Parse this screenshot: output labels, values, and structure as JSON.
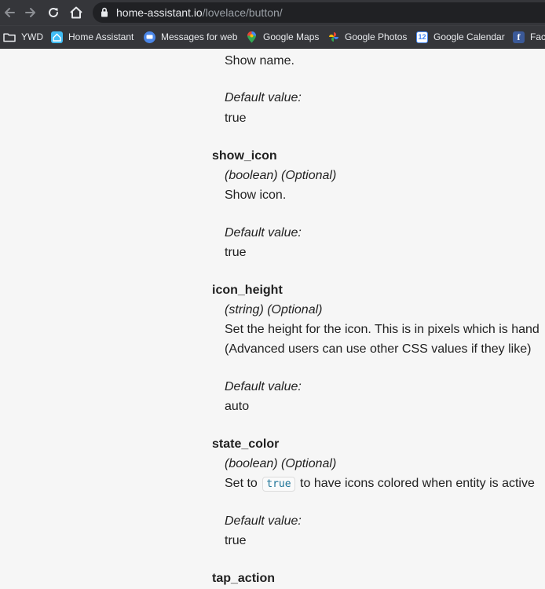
{
  "browser": {
    "url_host": "home-assistant.io",
    "url_path": "/lovelace/button/",
    "bookmarks": [
      {
        "label": "YWD",
        "icon": "folder-icon"
      },
      {
        "label": "Home Assistant",
        "icon": "home-assistant-icon"
      },
      {
        "label": "Messages for web",
        "icon": "messages-icon"
      },
      {
        "label": "Google Maps",
        "icon": "google-maps-icon"
      },
      {
        "label": "Google Photos",
        "icon": "google-photos-icon"
      },
      {
        "label": "Google Calendar",
        "icon": "google-calendar-icon",
        "badge": "12"
      },
      {
        "label": "Face",
        "icon": "facebook-icon",
        "badge": "f"
      }
    ]
  },
  "doc": {
    "show_name": {
      "description": "Show name.",
      "default_label": "Default value:",
      "default_value": "true"
    },
    "show_icon": {
      "name": "show_icon",
      "type": "(boolean) (Optional)",
      "description": "Show icon.",
      "default_label": "Default value:",
      "default_value": "true"
    },
    "icon_height": {
      "name": "icon_height",
      "type": "(string) (Optional)",
      "description_line1": "Set the height for the icon. This is in pixels which is hand",
      "description_line2": "(Advanced users can use other CSS values if they like)",
      "default_label": "Default value:",
      "default_value": "auto"
    },
    "state_color": {
      "name": "state_color",
      "type": "(boolean) (Optional)",
      "description_before": "Set to",
      "description_code": "true",
      "description_after": "to have icons colored when entity is active",
      "default_label": "Default value:",
      "default_value": "true"
    },
    "tap_action": {
      "name": "tap_action"
    }
  }
}
